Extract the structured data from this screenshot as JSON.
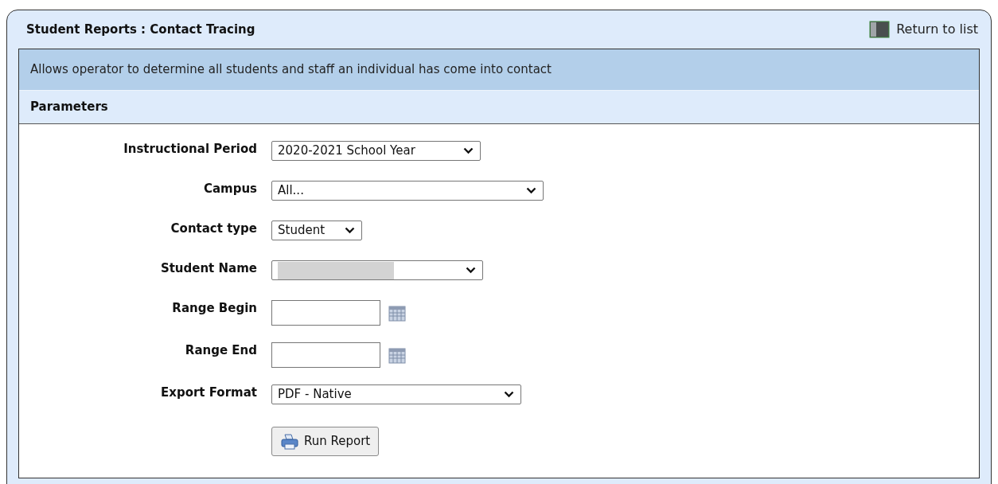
{
  "header": {
    "title": "Student Reports : Contact Tracing",
    "return_link": "Return to list"
  },
  "description": "Allows operator to determine all students and staff an individual has come into contact",
  "section_title": "Parameters",
  "fields": [
    {
      "label": "Instructional Period",
      "kind": "select",
      "value": "2020-2021 School Year"
    },
    {
      "label": "Campus",
      "kind": "select",
      "value": "All..."
    },
    {
      "label": "Contact type",
      "kind": "select",
      "value": "Student"
    },
    {
      "label": "Student Name",
      "kind": "redacted_select"
    },
    {
      "label": "Range Begin",
      "kind": "date"
    },
    {
      "label": "Range End",
      "kind": "date"
    },
    {
      "label": "Export Format",
      "kind": "select",
      "value": "PDF - Native"
    }
  ],
  "run_button": "Run Report"
}
